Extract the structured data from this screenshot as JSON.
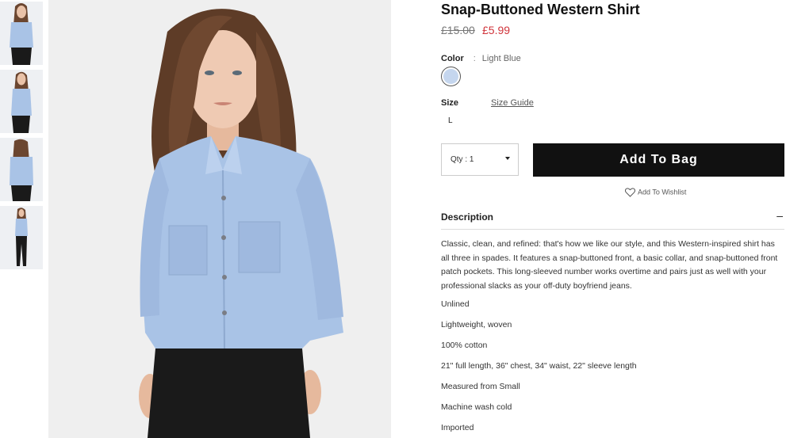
{
  "product": {
    "title": "Snap-Buttoned Western Shirt",
    "price_old": "£15.00",
    "price_new": "£5.99",
    "color_label": "Color",
    "color_separator": ":",
    "color_value": "Light Blue",
    "swatch_color": "#c5d6ee",
    "size_label": "Size",
    "size_guide": "Size Guide",
    "size_option": "L"
  },
  "purchase": {
    "qty_label": "Qty : 1",
    "add_to_bag": "Add To Bag",
    "wishlist": "Add To Wishlist"
  },
  "description": {
    "heading": "Description",
    "toggle": "–",
    "text": "Classic, clean, and refined: that's how we like our style, and this Western-inspired shirt has all three in spades. It features a snap-buttoned front, a basic collar, and snap-buttoned front patch pockets. This long-sleeved number works overtime and pairs just as well with your professional slacks as your off-duty boyfriend jeans.",
    "features": [
      "Unlined",
      "Lightweight, woven",
      "100% cotton",
      "21\" full length, 36\" chest, 34\" waist, 22\" sleeve length",
      "Measured from Small",
      "Machine wash cold",
      "Imported"
    ]
  },
  "icons": {
    "heart": "heart-icon",
    "caret": "caret-down-icon",
    "collapse": "minus-icon"
  },
  "colors": {
    "accent_black": "#111111",
    "sale_red": "#d0343b",
    "shirt_blue": "#a9c3e6"
  }
}
